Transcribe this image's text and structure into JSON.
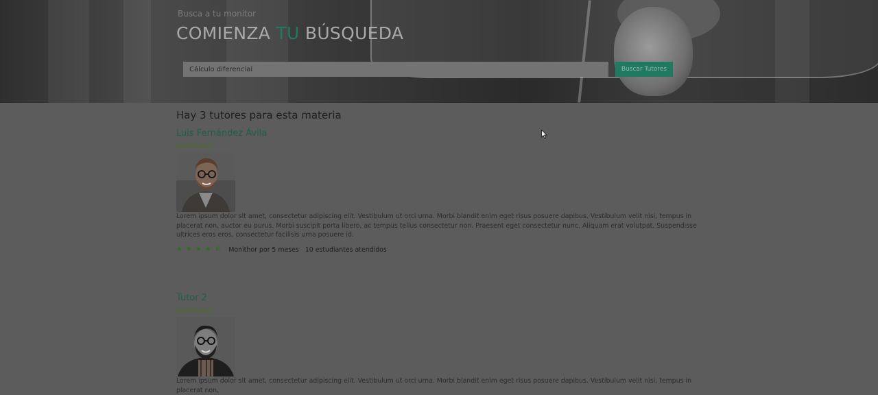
{
  "hero": {
    "subtitle": "Busca a tu monitor",
    "title_part1": "COMIENZA ",
    "title_accent": "TU",
    "title_part2": " BÚSQUEDA",
    "search_value": "Cálculo diferencial",
    "search_button": "Buscar Tutores"
  },
  "results": {
    "count_text": "Hay 3 tutores para esta materia",
    "tutors": [
      {
        "name": "Luis Fernández Ávila",
        "status": "DISPONIBLE",
        "bio": "Lorem ipsum dolor sit amet, consectetur adipiscing elit. Vestibulum ut orci urna. Morbi blandit enim eget risus posuere dapibus. Vestibulum velit nisi, tempus in placerat non, auctor eu purus. Morbi suscipit porta libero, ac tempus tellus consectetur non. Praesent eget consectetur nunc. Aliquam erat volutpat. Suspendisse ultrices eros eros, consectetur facilisis urna posuere id.",
        "rating": 4.5,
        "stars": "★★★★⯪",
        "experience": "Monithor por 5 meses",
        "students": "10 estudiantes atendidos"
      },
      {
        "name": "Tutor 2",
        "status": "DISPONIBLE",
        "bio": "Lorem ipsum dolor sit amet, consectetur adipiscing elit. Vestibulum ut orci urna. Morbi blandit enim eget risus posuere dapibus. Vestibulum velit nisi, tempus in placerat non,"
      }
    ]
  },
  "colors": {
    "accent": "#1f7a62",
    "overlay": "#5c5c5c",
    "status": "#4e6b2a"
  },
  "icons": {
    "star": "star-icon",
    "cursor": "mouse-cursor-icon"
  }
}
